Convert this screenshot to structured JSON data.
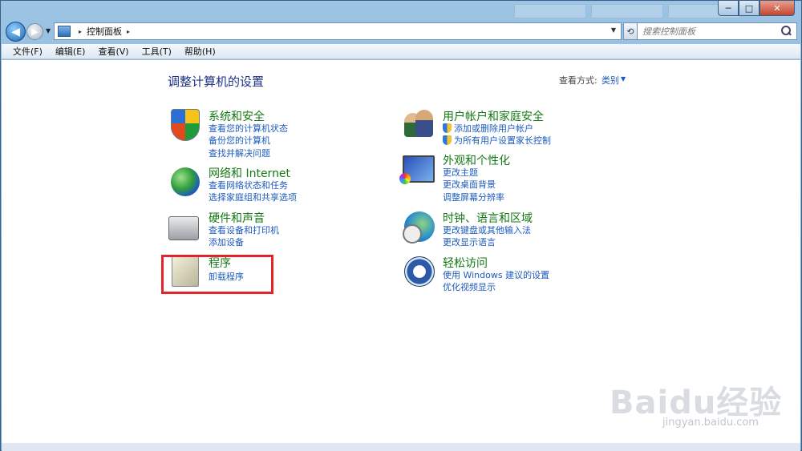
{
  "window": {
    "controls": {
      "minimize": "─",
      "maximize": "□",
      "close": "✕"
    },
    "bg_tabs": [
      "",
      "",
      ""
    ]
  },
  "address": {
    "path": "控制面板",
    "separator": "▸",
    "search_placeholder": "搜索控制面板"
  },
  "menu": [
    "文件(F)",
    "编辑(E)",
    "查看(V)",
    "工具(T)",
    "帮助(H)"
  ],
  "content": {
    "heading": "调整计算机的设置",
    "view_by_label": "查看方式:",
    "view_by_value": "类别",
    "categories": [
      {
        "title": "系统和安全",
        "icon": "security-shield-icon",
        "links": [
          "查看您的计算机状态",
          "备份您的计算机",
          "查找并解决问题"
        ]
      },
      {
        "title": "网络和 Internet",
        "icon": "network-globe-icon",
        "links": [
          "查看网络状态和任务",
          "选择家庭组和共享选项"
        ]
      },
      {
        "title": "硬件和声音",
        "icon": "printer-icon",
        "links": [
          "查看设备和打印机",
          "添加设备"
        ]
      },
      {
        "title": "程序",
        "icon": "programs-icon",
        "links": [
          "卸载程序"
        ]
      },
      {
        "title": "用户帐户和家庭安全",
        "icon": "users-icon",
        "links": [
          "添加或删除用户帐户",
          "为所有用户设置家长控制"
        ]
      },
      {
        "title": "外观和个性化",
        "icon": "display-icon",
        "links": [
          "更改主题",
          "更改桌面背景",
          "调整屏幕分辨率"
        ]
      },
      {
        "title": "时钟、语言和区域",
        "icon": "clock-globe-icon",
        "links": [
          "更改键盘或其他输入法",
          "更改显示语言"
        ]
      },
      {
        "title": "轻松访问",
        "icon": "ease-of-access-icon",
        "links": [
          "使用 Windows 建议的设置",
          "优化视频显示"
        ]
      }
    ]
  },
  "watermark": {
    "brand": "Baidu经验",
    "url": "jingyan.baidu.com"
  },
  "colors": {
    "link": "#1d5bbf",
    "category_title": "#147814",
    "highlight": "#e3252b"
  }
}
